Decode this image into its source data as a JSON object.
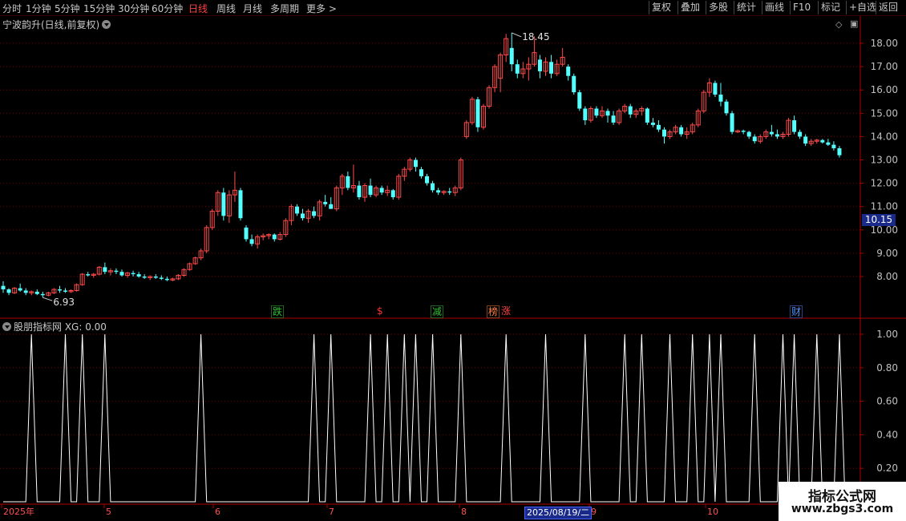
{
  "toolbar": {
    "left": [
      "分时",
      "1分钟",
      "5分钟",
      "15分钟",
      "30分钟",
      "60分钟",
      "日线",
      "周线",
      "月线",
      "多周期",
      "更多 >"
    ],
    "active": "日线",
    "right": [
      "复权",
      "叠加",
      "多股",
      "统计",
      "画线",
      "F10",
      "标记",
      "+自选",
      "返回"
    ]
  },
  "stock_title": "宁波韵升(日线,前复权)",
  "indicator_title": "股朋指标网 XG: 0.00",
  "price_tag": "10.15",
  "high_label": "18.45",
  "low_label": "6.93",
  "selected_date": "2025/08/19/二",
  "watermark": {
    "line1": "指标公式网",
    "line2": "www.zbgs3.com"
  },
  "badges": [
    {
      "text": "跌",
      "color": "#30c030"
    },
    {
      "text": "$",
      "color": "#ff3030"
    },
    {
      "text": "减",
      "color": "#30c030"
    },
    {
      "text": "榜",
      "color": "#ff8040"
    },
    {
      "text": "涨",
      "color": "#ff4040"
    },
    {
      "text": "财",
      "color": "#5090ff"
    }
  ],
  "colors": {
    "up": "#ff4a4a",
    "down": "#54ffff",
    "grid": "#7a0000",
    "axis": "#b00000",
    "signal": "#ffffff"
  },
  "chart_data": [
    {
      "type": "candlestick",
      "yticks": [
        8.0,
        9.0,
        10.0,
        11.0,
        12.0,
        13.0,
        14.0,
        15.0,
        16.0,
        17.0,
        18.0
      ],
      "ylim": [
        6.5,
        18.9
      ],
      "xticks": [
        "2025年",
        "5",
        "6",
        "7",
        "8",
        "9",
        "10"
      ],
      "ohlc": [
        [
          7.6,
          7.8,
          7.3,
          7.45
        ],
        [
          7.45,
          7.5,
          7.2,
          7.3
        ],
        [
          7.3,
          7.55,
          7.25,
          7.5
        ],
        [
          7.5,
          7.7,
          7.35,
          7.4
        ],
        [
          7.4,
          7.5,
          7.2,
          7.3
        ],
        [
          7.3,
          7.4,
          7.2,
          7.35
        ],
        [
          7.35,
          7.45,
          7.2,
          7.25
        ],
        [
          7.25,
          7.35,
          7.1,
          7.2
        ],
        [
          7.2,
          7.35,
          7.15,
          7.3
        ],
        [
          7.3,
          7.5,
          7.25,
          7.45
        ],
        [
          7.45,
          7.6,
          7.3,
          7.4
        ],
        [
          7.4,
          7.5,
          7.3,
          7.35
        ],
        [
          7.35,
          7.45,
          7.3,
          7.4
        ],
        [
          7.4,
          7.7,
          7.35,
          7.65
        ],
        [
          7.65,
          8.15,
          7.6,
          8.1
        ],
        [
          8.1,
          8.2,
          8.0,
          8.05
        ],
        [
          8.05,
          8.15,
          7.95,
          8.1
        ],
        [
          8.1,
          8.45,
          8.05,
          8.4
        ],
        [
          8.4,
          8.6,
          8.1,
          8.2
        ],
        [
          8.2,
          8.35,
          8.05,
          8.25
        ],
        [
          8.25,
          8.35,
          8.1,
          8.2
        ],
        [
          8.2,
          8.3,
          8.0,
          8.05
        ],
        [
          8.05,
          8.2,
          7.95,
          8.15
        ],
        [
          8.15,
          8.25,
          8.0,
          8.1
        ],
        [
          8.1,
          8.2,
          7.95,
          8.0
        ],
        [
          8.0,
          8.1,
          7.9,
          7.95
        ],
        [
          7.95,
          8.05,
          7.85,
          8.0
        ],
        [
          8.0,
          8.1,
          7.9,
          7.95
        ],
        [
          7.95,
          8.05,
          7.85,
          7.9
        ],
        [
          7.9,
          8.0,
          7.8,
          7.85
        ],
        [
          7.85,
          7.95,
          7.8,
          7.9
        ],
        [
          7.9,
          8.1,
          7.85,
          8.05
        ],
        [
          8.05,
          8.35,
          8.0,
          8.3
        ],
        [
          8.3,
          8.6,
          8.25,
          8.55
        ],
        [
          8.55,
          8.85,
          8.5,
          8.8
        ],
        [
          8.8,
          9.2,
          8.7,
          9.1
        ],
        [
          9.1,
          10.2,
          9.0,
          10.1
        ],
        [
          10.1,
          10.9,
          10.0,
          10.8
        ],
        [
          10.8,
          11.7,
          10.6,
          11.6
        ],
        [
          11.6,
          11.8,
          10.4,
          10.6
        ],
        [
          10.6,
          11.7,
          10.3,
          11.5
        ],
        [
          11.5,
          12.5,
          11.2,
          11.7
        ],
        [
          11.7,
          11.8,
          10.4,
          10.5
        ],
        [
          10.1,
          10.2,
          9.5,
          9.6
        ],
        [
          9.6,
          9.8,
          9.3,
          9.4
        ],
        [
          9.4,
          9.8,
          9.2,
          9.7
        ],
        [
          9.7,
          9.85,
          9.55,
          9.75
        ],
        [
          9.75,
          9.85,
          9.6,
          9.8
        ],
        [
          9.8,
          9.85,
          9.5,
          9.6
        ],
        [
          9.6,
          9.9,
          9.55,
          9.8
        ],
        [
          9.8,
          10.5,
          9.7,
          10.4
        ],
        [
          10.4,
          11.1,
          10.2,
          11.0
        ],
        [
          11.0,
          11.1,
          10.6,
          10.7
        ],
        [
          10.7,
          10.9,
          10.4,
          10.5
        ],
        [
          10.5,
          10.9,
          10.3,
          10.8
        ],
        [
          10.8,
          11.0,
          10.5,
          10.6
        ],
        [
          10.6,
          11.3,
          10.4,
          11.2
        ],
        [
          11.2,
          11.5,
          11.0,
          11.1
        ],
        [
          11.1,
          11.4,
          10.9,
          10.9
        ],
        [
          10.9,
          11.9,
          10.8,
          11.8
        ],
        [
          11.8,
          12.4,
          11.5,
          12.3
        ],
        [
          12.3,
          12.5,
          11.7,
          11.8
        ],
        [
          11.8,
          12.8,
          11.6,
          11.9
        ],
        [
          11.9,
          12.1,
          11.3,
          11.4
        ],
        [
          11.4,
          12.0,
          11.2,
          11.9
        ],
        [
          11.9,
          12.2,
          11.4,
          11.5
        ],
        [
          11.5,
          11.9,
          11.4,
          11.8
        ],
        [
          11.8,
          11.9,
          11.5,
          11.6
        ],
        [
          11.6,
          11.9,
          11.45,
          11.7
        ],
        [
          11.7,
          11.75,
          11.3,
          11.4
        ],
        [
          11.4,
          12.4,
          11.3,
          12.3
        ],
        [
          12.3,
          12.7,
          12.1,
          12.6
        ],
        [
          12.6,
          13.1,
          12.5,
          13.0
        ],
        [
          13.0,
          13.1,
          12.5,
          12.7
        ],
        [
          12.6,
          12.7,
          12.2,
          12.3
        ],
        [
          12.3,
          12.4,
          11.9,
          12.0
        ],
        [
          12.0,
          12.1,
          11.6,
          11.7
        ],
        [
          11.7,
          11.8,
          11.5,
          11.6
        ],
        [
          11.6,
          11.7,
          11.5,
          11.65
        ],
        [
          11.65,
          11.8,
          11.5,
          11.6
        ],
        [
          11.6,
          11.9,
          11.45,
          11.8
        ],
        [
          11.8,
          13.1,
          11.7,
          13.0
        ],
        [
          14.0,
          14.7,
          13.9,
          14.6
        ],
        [
          14.6,
          15.7,
          14.5,
          15.6
        ],
        [
          15.6,
          15.7,
          14.2,
          14.4
        ],
        [
          14.4,
          15.4,
          14.3,
          15.3
        ],
        [
          15.3,
          16.2,
          15.2,
          16.1
        ],
        [
          16.1,
          17.1,
          15.9,
          17.0
        ],
        [
          16.5,
          17.6,
          15.9,
          17.5
        ],
        [
          17.5,
          18.4,
          17.2,
          18.2
        ],
        [
          17.8,
          18.45,
          16.8,
          17.1
        ],
        [
          17.1,
          17.3,
          16.5,
          16.7
        ],
        [
          16.7,
          17.2,
          16.5,
          16.9
        ],
        [
          16.9,
          17.4,
          16.4,
          17.1
        ],
        [
          17.1,
          18.3,
          17.0,
          17.6
        ],
        [
          17.3,
          17.5,
          16.5,
          16.8
        ],
        [
          16.8,
          17.4,
          16.6,
          17.2
        ],
        [
          17.2,
          17.5,
          16.5,
          16.7
        ],
        [
          16.7,
          17.3,
          16.6,
          17.1
        ],
        [
          17.1,
          17.8,
          17.0,
          17.4
        ],
        [
          17.0,
          17.1,
          16.4,
          16.6
        ],
        [
          16.6,
          16.7,
          15.8,
          15.9
        ],
        [
          15.9,
          16.0,
          15.1,
          15.2
        ],
        [
          15.2,
          15.3,
          14.5,
          14.7
        ],
        [
          14.7,
          15.3,
          14.6,
          15.2
        ],
        [
          15.2,
          15.3,
          14.8,
          14.9
        ],
        [
          14.9,
          15.3,
          14.8,
          15.1
        ],
        [
          15.1,
          15.2,
          14.6,
          14.9
        ],
        [
          14.9,
          15.1,
          14.5,
          14.6
        ],
        [
          14.6,
          15.2,
          14.5,
          15.1
        ],
        [
          15.1,
          15.4,
          15.0,
          15.3
        ],
        [
          15.3,
          15.4,
          14.8,
          14.95
        ],
        [
          14.95,
          15.2,
          14.8,
          15.1
        ],
        [
          15.1,
          15.3,
          14.9,
          15.2
        ],
        [
          15.2,
          15.25,
          14.5,
          14.6
        ],
        [
          14.6,
          14.8,
          14.4,
          14.5
        ],
        [
          14.5,
          14.7,
          14.2,
          14.3
        ],
        [
          14.3,
          14.4,
          13.7,
          14.0
        ],
        [
          14.0,
          14.3,
          13.9,
          14.2
        ],
        [
          14.2,
          14.5,
          14.1,
          14.4
        ],
        [
          14.4,
          14.5,
          14.0,
          14.1
        ],
        [
          14.1,
          14.4,
          13.9,
          14.2
        ],
        [
          14.2,
          14.6,
          14.1,
          14.5
        ],
        [
          14.5,
          15.2,
          14.4,
          15.1
        ],
        [
          15.1,
          16.0,
          15.0,
          15.9
        ],
        [
          15.9,
          16.5,
          15.7,
          16.3
        ],
        [
          16.3,
          16.4,
          15.7,
          15.8
        ],
        [
          15.8,
          16.3,
          15.3,
          15.5
        ],
        [
          15.5,
          15.6,
          14.9,
          15.0
        ],
        [
          15.0,
          15.1,
          14.1,
          14.2
        ],
        [
          14.2,
          14.3,
          14.15,
          14.25
        ],
        [
          14.25,
          14.3,
          14.1,
          14.2
        ],
        [
          14.2,
          14.25,
          13.9,
          14.0
        ],
        [
          14.0,
          14.1,
          13.7,
          13.8
        ],
        [
          13.8,
          14.1,
          13.7,
          14.0
        ],
        [
          14.0,
          14.3,
          13.9,
          14.2
        ],
        [
          14.2,
          14.5,
          14.0,
          14.1
        ],
        [
          14.1,
          14.3,
          13.9,
          14.0
        ],
        [
          14.0,
          14.2,
          13.9,
          14.1
        ],
        [
          14.1,
          14.8,
          14.0,
          14.7
        ],
        [
          14.7,
          14.9,
          14.1,
          14.2
        ],
        [
          14.2,
          14.3,
          13.9,
          14.0
        ],
        [
          14.0,
          14.1,
          13.6,
          13.7
        ],
        [
          13.7,
          13.9,
          13.6,
          13.8
        ],
        [
          13.8,
          13.9,
          13.7,
          13.85
        ],
        [
          13.85,
          13.9,
          13.7,
          13.75
        ],
        [
          13.75,
          13.9,
          13.6,
          13.65
        ],
        [
          13.65,
          13.8,
          13.4,
          13.5
        ],
        [
          13.5,
          13.6,
          13.1,
          13.2
        ]
      ]
    },
    {
      "type": "line",
      "series": [
        {
          "name": "XG",
          "values": [
            0,
            0,
            0,
            0,
            0,
            1,
            0,
            0,
            0,
            0,
            0,
            1,
            0,
            0,
            1,
            0,
            0,
            0,
            1,
            0,
            0,
            0,
            0,
            0,
            0,
            0,
            0,
            0,
            0,
            0,
            0,
            0,
            0,
            0,
            0,
            1,
            0,
            0,
            0,
            0,
            0,
            0,
            0,
            0,
            0,
            0,
            0,
            0,
            0,
            0,
            0,
            0,
            0,
            0,
            0,
            1,
            0,
            0,
            1,
            0,
            0,
            0,
            0,
            0,
            0,
            1,
            0,
            0,
            1,
            0,
            0,
            1,
            0,
            1,
            0,
            0,
            1,
            0,
            0,
            0,
            0,
            1,
            0,
            0,
            0,
            0,
            0,
            0,
            0,
            1,
            0,
            0,
            0,
            0,
            0,
            0,
            1,
            0,
            0,
            0,
            0,
            0,
            0,
            1,
            0,
            0,
            0,
            0,
            0,
            0,
            1,
            0,
            0,
            1,
            0,
            0,
            0,
            0,
            1,
            0,
            0,
            0,
            1,
            0,
            0,
            1,
            0,
            1,
            0,
            0,
            0,
            0,
            0,
            1,
            0,
            0,
            0,
            0,
            1,
            0,
            1,
            0,
            0,
            0,
            1,
            0,
            0,
            0,
            1,
            0,
            0,
            0,
            0,
            0,
            0,
            0
          ]
        }
      ],
      "yticks": [
        0.2,
        0.4,
        0.6,
        0.8,
        1.0
      ],
      "ylim": [
        -0.05,
        1.05
      ]
    }
  ]
}
